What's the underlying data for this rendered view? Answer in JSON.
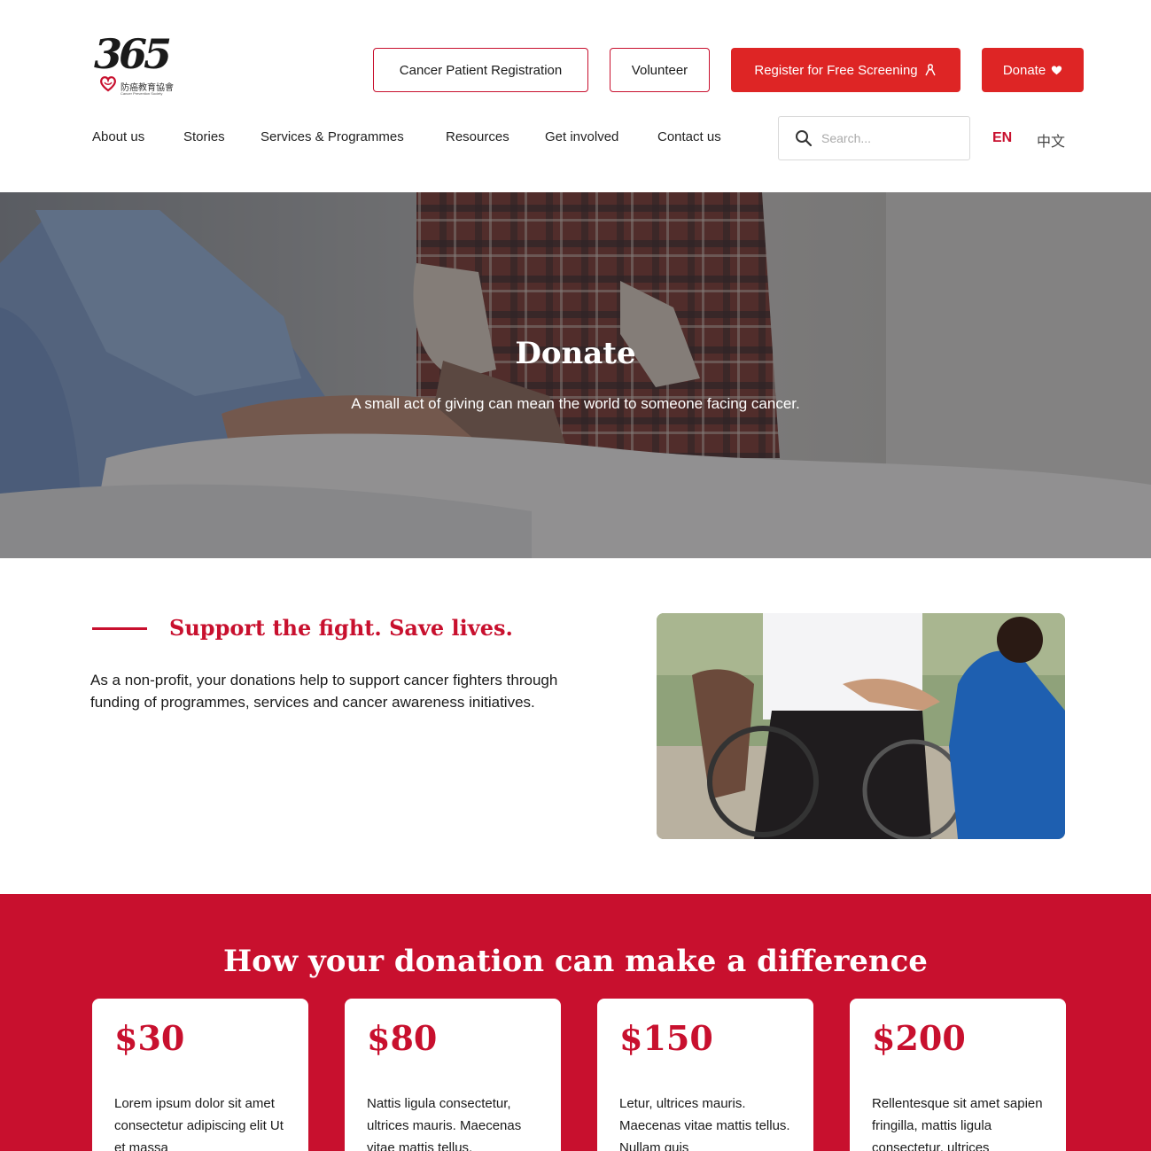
{
  "header": {
    "logo": {
      "number": "365",
      "chinese_name": "防癌教育協會",
      "english_name": "Cancer Prevention Society"
    },
    "buttons": {
      "registration": "Cancer Patient Registration",
      "volunteer": "Volunteer",
      "screening": "Register for Free Screening",
      "donate": "Donate"
    },
    "nav": [
      "About us",
      "Stories",
      "Services & Programmes",
      "Resources",
      "Get involved",
      "Contact us"
    ],
    "search": {
      "placeholder": "Search..."
    },
    "languages": {
      "active": "EN",
      "other": "中文"
    }
  },
  "hero": {
    "title": "Donate",
    "subtitle": "A small act of giving can mean the world to someone facing cancer."
  },
  "support": {
    "title": "Support the fight. Save lives.",
    "body": "As a non-profit, your donations help to support cancer fighters through funding of programmes, services and cancer awareness initiatives."
  },
  "donation": {
    "title": "How your donation can make a difference",
    "cards": [
      {
        "amount": "$30",
        "text": "Lorem ipsum dolor sit amet consectetur adipiscing elit Ut et massa"
      },
      {
        "amount": "$80",
        "text": "Nattis ligula consectetur, ultrices mauris. Maecenas vitae mattis tellus."
      },
      {
        "amount": "$150",
        "text": "Letur, ultrices mauris. Maecenas vitae mattis tellus. Nullam quis"
      },
      {
        "amount": "$200",
        "text": "Rellentesque sit amet sapien fringilla, mattis ligula consectetur, ultrices"
      }
    ]
  },
  "colors": {
    "brand_red": "#c8102e",
    "button_red": "#de2525"
  },
  "icons": [
    "heart-icon",
    "ribbon-icon",
    "search-icon"
  ]
}
